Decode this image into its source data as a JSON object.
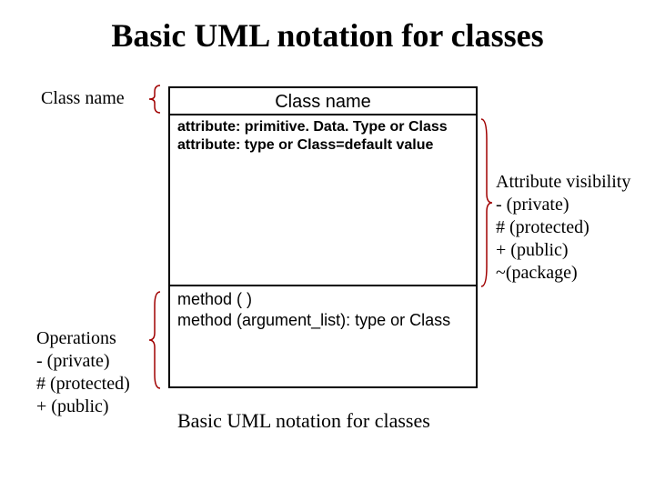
{
  "title": "Basic UML notation for classes",
  "labels": {
    "left_top": "Class  name",
    "left_bottom": "Operations\n- (private)\n# (protected)\n+ (public)",
    "right": "Attribute visibility\n- (private)\n# (protected)\n+ (public)\n~(package)"
  },
  "uml": {
    "class_name": "Class name",
    "attributes": "attribute: primitive. Data. Type or Class\nattribute: type or Class=default value",
    "operations": "method ( )\nmethod (argument_list): type or Class"
  },
  "caption": "Basic UML notation for classes"
}
